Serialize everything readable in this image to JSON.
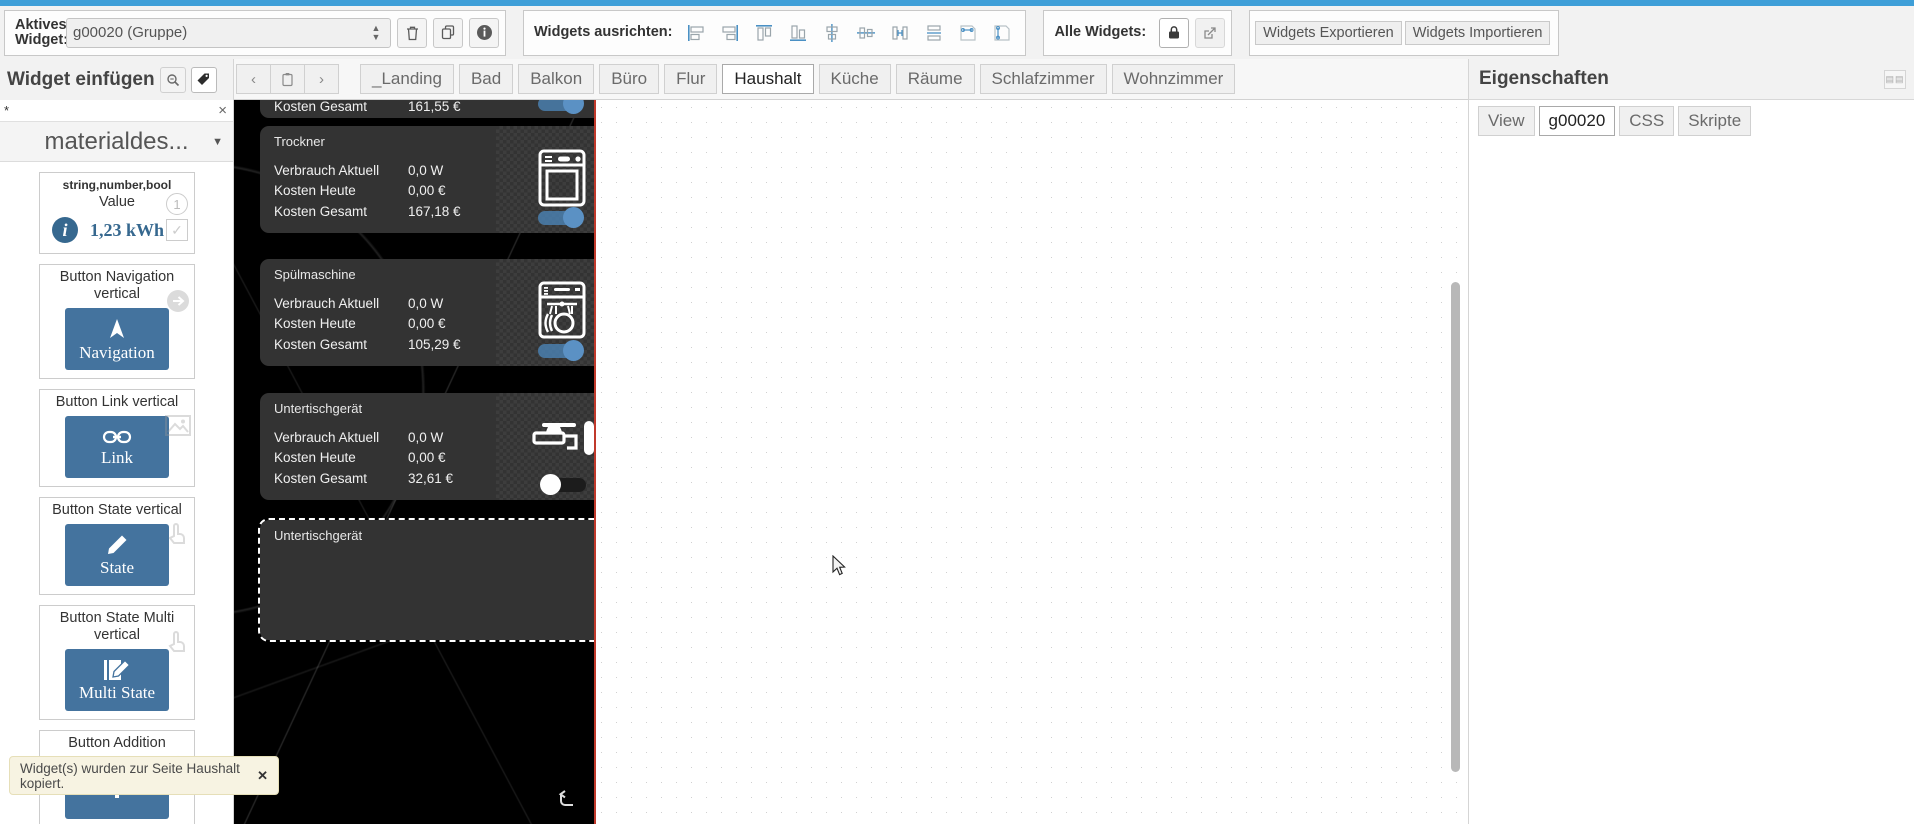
{
  "toolbar": {
    "active_widget_label": "Aktives\nWidget:",
    "active_widget_label_l1": "Aktives",
    "active_widget_label_l2": "Widget:",
    "active_widget_value": "g00020 (Gruppe)",
    "delete_icon": "trash-icon",
    "copy_icon": "copy-icon",
    "info_icon": "info-icon",
    "align_label": "Widgets ausrichten:",
    "align_buttons": [
      "align-left-icon",
      "align-right-icon",
      "align-top-icon",
      "align-bottom-icon",
      "align-center-horizontal-icon",
      "align-center-vertical-icon",
      "distribute-horizontal-icon",
      "distribute-vertical-icon",
      "size-width-icon",
      "size-height-icon"
    ],
    "all_widgets_label": "Alle Widgets:",
    "lock_icon": "lock-icon",
    "expand_icon": "expand-icon",
    "export_label": "Widgets Exportieren",
    "import_label": "Widgets Importieren"
  },
  "insert_panel": {
    "title": "Widget einfügen",
    "search_icon": "search-icon",
    "tag_icon": "tag-icon",
    "filter_value": "*",
    "filter_clear": "×",
    "category": "materialdes...",
    "category_caret": "▼",
    "widgets": [
      {
        "subtitle": "string,number,bool",
        "title": "Value",
        "value_text": "1,23 kWh",
        "info_glyph": "i",
        "badge": "1",
        "check_glyph": "✓",
        "type": "value"
      },
      {
        "title": "Button Navigation vertical",
        "label": "Navigation",
        "icon": "navigation-arrow-icon",
        "corner_icon": "arrow-right-circle-icon",
        "type": "button"
      },
      {
        "title": "Button Link vertical",
        "label": "Link",
        "icon": "link-icon",
        "corner_icon": "image-icon",
        "type": "button"
      },
      {
        "title": "Button State vertical",
        "label": "State",
        "icon": "pencil-icon",
        "corner_icon": "hand-pointer-icon",
        "type": "button"
      },
      {
        "title": "Button State Multi vertical",
        "label": "Multi State",
        "icon": "multi-pencil-icon",
        "corner_icon": "hand-pointer-icon",
        "type": "button"
      },
      {
        "title": "Button Addition",
        "label": "",
        "icon": "plus-icon",
        "corner_icon": "home-icon",
        "type": "button"
      }
    ]
  },
  "nav": {
    "prev": "‹",
    "paste": "paste-icon",
    "next": "›",
    "tabs": [
      {
        "label": "_Landing",
        "active": false
      },
      {
        "label": "Bad",
        "active": false
      },
      {
        "label": "Balkon",
        "active": false
      },
      {
        "label": "Büro",
        "active": false
      },
      {
        "label": "Flur",
        "active": false
      },
      {
        "label": "Haushalt",
        "active": true
      },
      {
        "label": "Küche",
        "active": false
      },
      {
        "label": "Räume",
        "active": false
      },
      {
        "label": "Schlafzimmer",
        "active": false
      },
      {
        "label": "Wohnzimmer",
        "active": false
      }
    ]
  },
  "canvas": {
    "partial_card": {
      "rows": [
        {
          "key": "Kosten Gesamt",
          "value": "161,55 €"
        }
      ],
      "toggle": "on"
    },
    "cards": [
      {
        "title": "Trockner",
        "icon": "dryer-icon",
        "toggle": "on",
        "rows": [
          {
            "key": "Verbrauch Aktuell",
            "value": "0,0 W"
          },
          {
            "key": "Kosten Heute",
            "value": "0,00 €"
          },
          {
            "key": "Kosten Gesamt",
            "value": "167,18 €"
          }
        ]
      },
      {
        "title": "Spülmaschine",
        "icon": "dishwasher-icon",
        "toggle": "on",
        "rows": [
          {
            "key": "Verbrauch Aktuell",
            "value": "0,0 W"
          },
          {
            "key": "Kosten Heute",
            "value": "0,00 €"
          },
          {
            "key": "Kosten Gesamt",
            "value": "105,29 €"
          }
        ]
      },
      {
        "title": "Untertischgerät",
        "icon": "faucet-thermometer-icon",
        "toggle": "off",
        "rows": [
          {
            "key": "Verbrauch Aktuell",
            "value": "0,0 W"
          },
          {
            "key": "Kosten Heute",
            "value": "0,00 €"
          },
          {
            "key": "Kosten Gesamt",
            "value": "32,61 €"
          }
        ]
      }
    ],
    "selected_card": {
      "title": "Untertischgerät"
    },
    "back_icon": "back-arrow-icon"
  },
  "properties": {
    "title": "Eigenschaften",
    "grip_icon": "grip-icon",
    "tabs": [
      {
        "label": "View",
        "active": false
      },
      {
        "label": "g00020",
        "active": true
      },
      {
        "label": "CSS",
        "active": false
      },
      {
        "label": "Skripte",
        "active": false
      }
    ]
  },
  "toast": {
    "message": "Widget(s) wurden zur Seite Haushalt kopiert.",
    "close": "✕"
  },
  "colors": {
    "accent": "#3f9fd8",
    "widget_blue": "#44739e",
    "value_blue": "#36688f",
    "canvas_dark": "#333333",
    "phone_border": "#c0392b",
    "toast_bg": "#f7f3e2"
  }
}
